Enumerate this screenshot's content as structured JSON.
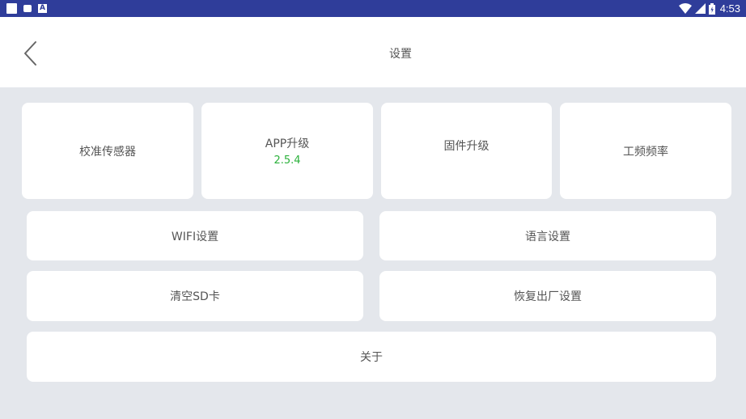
{
  "status_bar": {
    "time": "4:53",
    "left_icons": [
      "notification-square-icon",
      "sd-card-icon",
      "a-notification-icon"
    ],
    "right_icons": [
      "wifi-icon",
      "signal-icon",
      "battery-icon"
    ]
  },
  "header": {
    "title": "设置",
    "back_icon": "chevron-left-icon"
  },
  "settings": {
    "calibrate_sensor": "校准传感器",
    "app_upgrade": "APP升级",
    "app_version": "2.5.4",
    "firmware_upgrade": "固件升级",
    "power_frequency": "工频频率",
    "wifi_settings": "WIFI设置",
    "language_settings": "语言设置",
    "clear_sd": "清空SD卡",
    "factory_reset": "恢复出厂设置",
    "about": "关于"
  },
  "colors": {
    "status_bar": "#2f3d9a",
    "background": "#e4e7ec",
    "card": "#ffffff",
    "version_green": "#2bb13b"
  }
}
